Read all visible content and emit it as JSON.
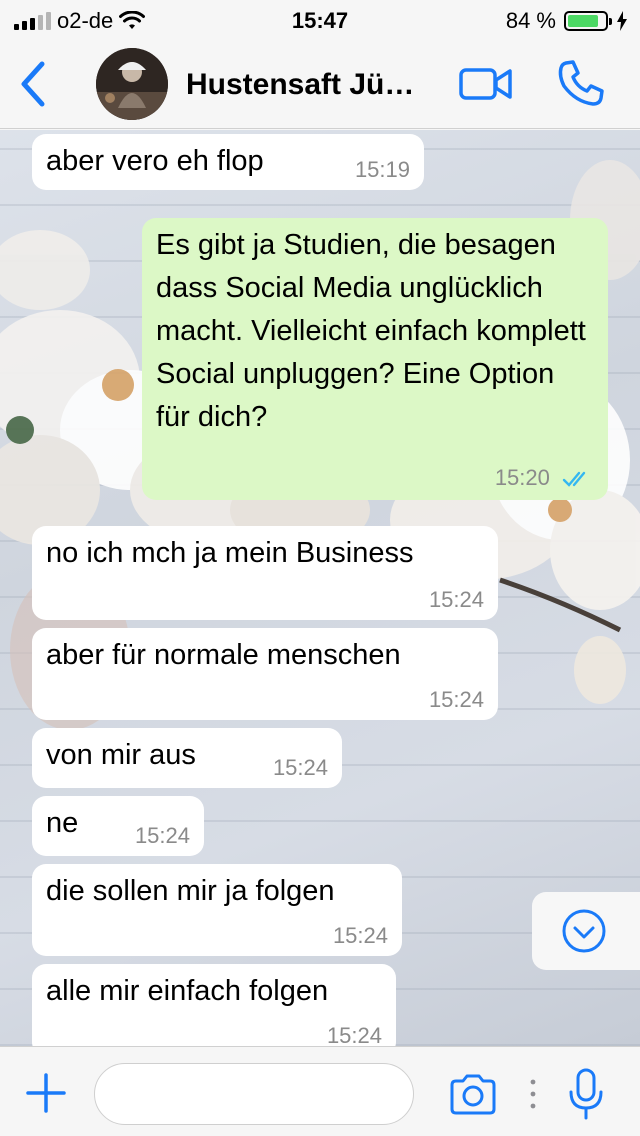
{
  "status": {
    "carrier": "o2-de",
    "time": "15:47",
    "battery": "84 %",
    "battery_level": 0.84
  },
  "header": {
    "contact_name": "Hustensaft Jü…"
  },
  "messages": [
    {
      "dir": "in",
      "text": "aber vero eh flop",
      "time": "15:19"
    },
    {
      "dir": "out",
      "text": "Es gibt ja Studien, die besagen dass Social Media unglücklich macht. Vielleicht einfach komplett Social unpluggen? Eine Option für dich?",
      "time": "15:20"
    },
    {
      "dir": "in",
      "text": "no ich mch ja mein Business",
      "time": "15:24"
    },
    {
      "dir": "in",
      "text": "aber für normale menschen",
      "time": "15:24"
    },
    {
      "dir": "in",
      "text": "von mir aus",
      "time": "15:24"
    },
    {
      "dir": "in",
      "text": "ne",
      "time": "15:24"
    },
    {
      "dir": "in",
      "text": "die sollen mir ja folgen",
      "time": "15:24"
    },
    {
      "dir": "in",
      "text": "alle mir einfach folgen",
      "time": "15:24"
    }
  ],
  "input": {
    "placeholder": "",
    "value": ""
  },
  "colors": {
    "accent": "#1a7af8",
    "outgoing_bubble": "#dcf8c6",
    "incoming_bubble": "#ffffff",
    "read_ticks": "#34b7f1"
  },
  "icons": [
    "back-chevron-icon",
    "video-call-icon",
    "phone-icon",
    "plus-icon",
    "camera-icon",
    "microphone-icon",
    "chevron-down-circle-icon",
    "read-receipt-icon"
  ]
}
